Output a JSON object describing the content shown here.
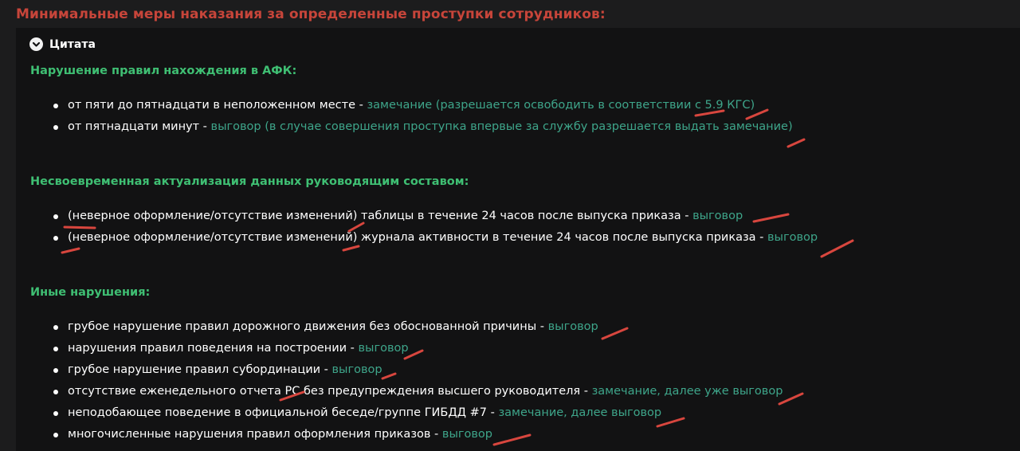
{
  "heading": "Минимальные меры наказания за определенные проступки сотрудников:",
  "quote": {
    "toggle_label": "Цитата",
    "toggle_icon": "chevron-down-icon"
  },
  "sections": [
    {
      "title": "Нарушение правил нахождения в АФК:",
      "items": [
        {
          "text": "от пяти до пятнадцати в неположенном месте - ",
          "penalty": "замечание (разрешается освободить в соответствии с 5.9 КГС)"
        },
        {
          "text": "от пятнадцати минут - ",
          "penalty": "выговор (в случае совершения проступка впервые за службу разрешается выдать замечание)"
        }
      ]
    },
    {
      "title": "Несвоевременная актуализация данных руководящим составом:",
      "items": [
        {
          "text": "(неверное оформление/отсутствие изменений) таблицы в течение 24 часов после выпуска приказа - ",
          "penalty": "выговор"
        },
        {
          "text": "(неверное оформление/отсутствие изменений) журнала активности в течение 24 часов после выпуска приказа - ",
          "penalty": "выговор"
        }
      ]
    },
    {
      "title": "Иные нарушения:",
      "items": [
        {
          "text": "грубое нарушение правил дорожного движения без обоснованной причины - ",
          "penalty": "выговор"
        },
        {
          "text": "нарушения правил поведения на построении - ",
          "penalty": "выговор"
        },
        {
          "text": "грубое нарушение правил субординации - ",
          "penalty": "выговор"
        },
        {
          "text": "отсутствие еженедельного отчета РС без предупреждения высшего руководителя - ",
          "penalty": "замечание, далее уже выговор"
        },
        {
          "text": "неподобающее поведение в официальной беседе/группе ГИБДД #7 - ",
          "penalty": "замечание, далее выговор"
        },
        {
          "text": "многочисленные нарушения правил оформления приказов - ",
          "penalty": "выговор"
        }
      ]
    }
  ],
  "colors": {
    "background": "#1c1c1d",
    "quote_background": "#121213",
    "heading": "#c7453a",
    "section_title": "#3fbf73",
    "penalty": "#3ea58a",
    "text": "#ffffff",
    "annotation": "#d8463e"
  }
}
